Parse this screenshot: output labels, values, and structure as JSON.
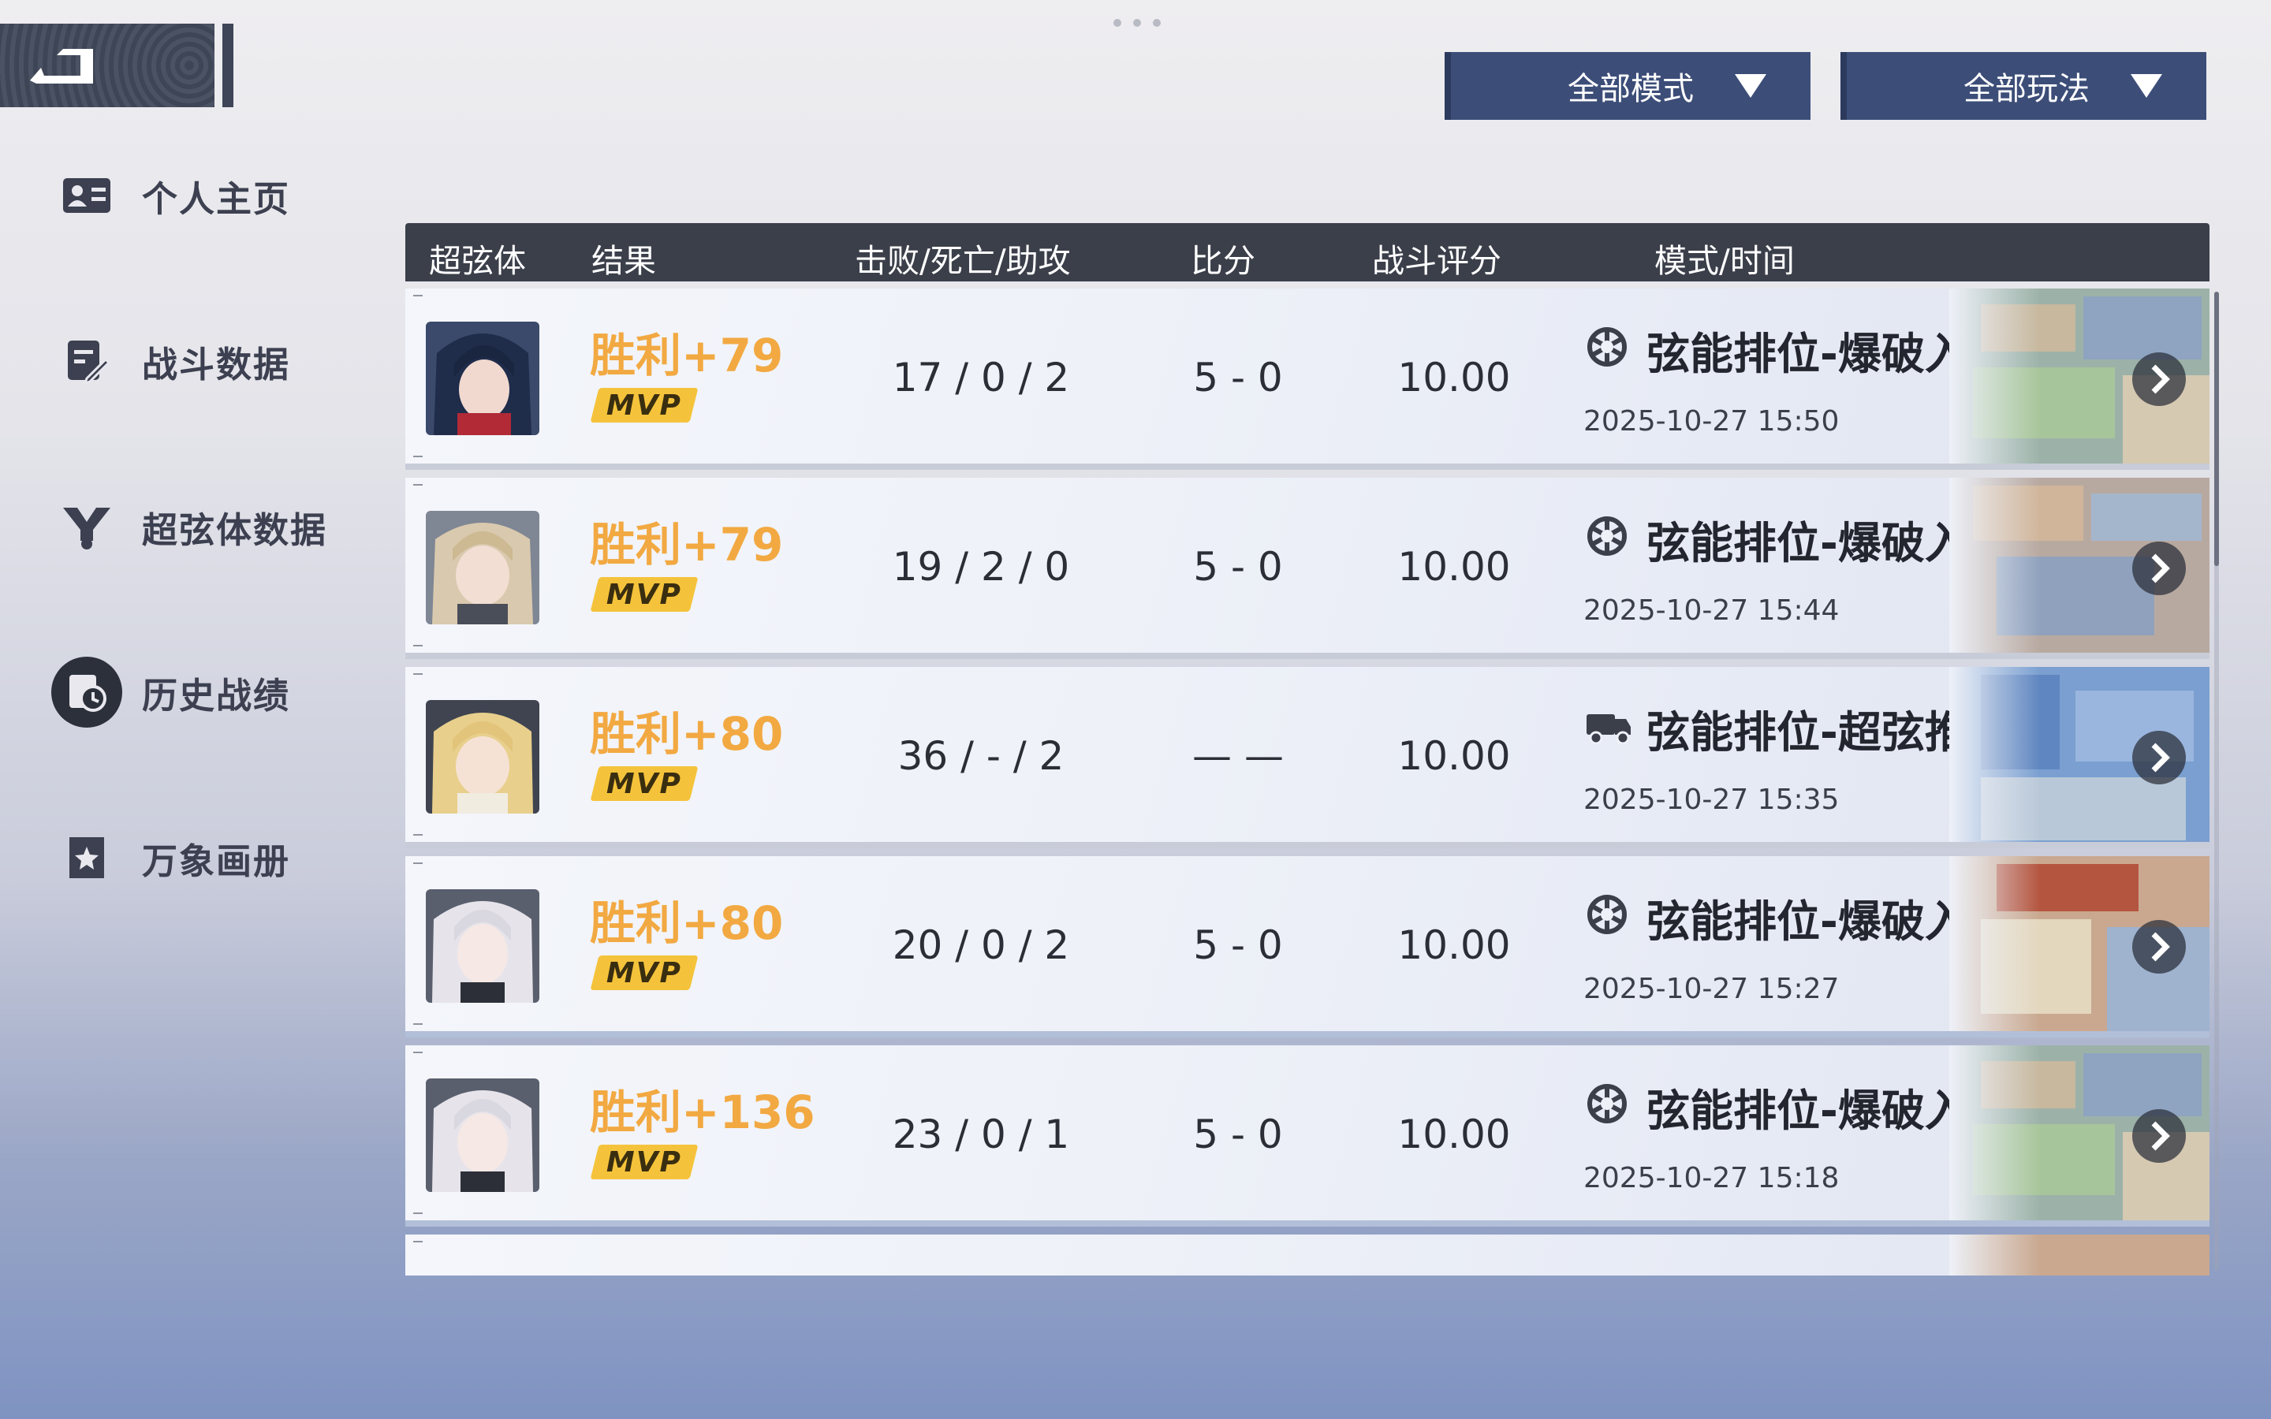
{
  "nav": {
    "items": [
      {
        "label": "个人主页",
        "icon": "id-card-icon"
      },
      {
        "label": "战斗数据",
        "icon": "edit-document-icon"
      },
      {
        "label": "超弦体数据",
        "icon": "y-emblem-icon"
      },
      {
        "label": "历史战绩",
        "icon": "history-clock-icon",
        "active": true
      },
      {
        "label": "万象画册",
        "icon": "star-album-icon"
      }
    ]
  },
  "filters": {
    "mode_label": "全部模式",
    "play_label": "全部玩法"
  },
  "table": {
    "headers": [
      "超弦体",
      "结果",
      "击败/死亡/助攻",
      "比分",
      "战斗评分",
      "模式/时间"
    ]
  },
  "records": [
    {
      "result": "胜利+79",
      "mvp": "MVP",
      "kda": "17 / 0 / 2",
      "score": "5 - 0",
      "rating": "10.00",
      "mode": "弦能排位-爆破入侵",
      "mode_icon": "detonation-icon",
      "time": "2025-10-27 15:50"
    },
    {
      "result": "胜利+79",
      "mvp": "MVP",
      "kda": "19 / 2 / 0",
      "score": "5 - 0",
      "rating": "10.00",
      "mode": "弦能排位-爆破入侵",
      "mode_icon": "detonation-icon",
      "time": "2025-10-27 15:44"
    },
    {
      "result": "胜利+80",
      "mvp": "MVP",
      "kda": "36 / - / 2",
      "score": "— —",
      "rating": "10.00",
      "mode": "弦能排位-超弦推进",
      "mode_icon": "truck-icon",
      "time": "2025-10-27 15:35"
    },
    {
      "result": "胜利+80",
      "mvp": "MVP",
      "kda": "20 / 0 / 2",
      "score": "5 - 0",
      "rating": "10.00",
      "mode": "弦能排位-爆破入侵",
      "mode_icon": "detonation-icon",
      "time": "2025-10-27 15:27"
    },
    {
      "result": "胜利+136",
      "mvp": "MVP",
      "kda": "23 / 0 / 1",
      "score": "5 - 0",
      "rating": "10.00",
      "mode": "弦能排位-爆破入侵",
      "mode_icon": "detonation-icon",
      "time": "2025-10-27 15:18"
    }
  ],
  "colors": {
    "accent_orange": "#f2a942",
    "mvp_yellow": "#f5c33b",
    "header_dark": "#3b3f4a",
    "dropdown_blue": "#3c4d78"
  }
}
